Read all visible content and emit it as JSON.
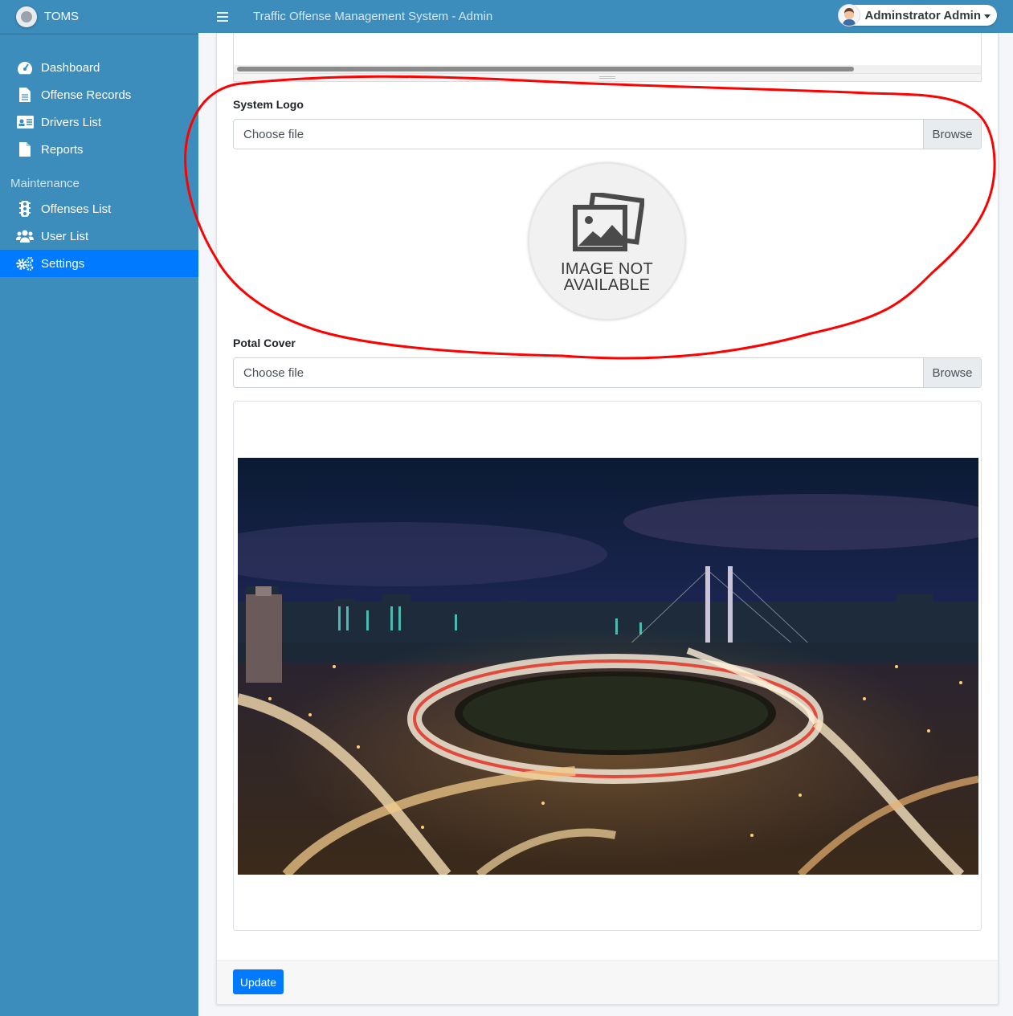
{
  "brand": {
    "name": "TOMS"
  },
  "header": {
    "title": "Traffic Offense Management System - Admin",
    "user_name": "Adminstrator Admin"
  },
  "sidebar": {
    "items": [
      {
        "label": "Dashboard",
        "icon": "tachometer-icon"
      },
      {
        "label": "Offense Records",
        "icon": "file-text-icon"
      },
      {
        "label": "Drivers List",
        "icon": "id-card-icon"
      },
      {
        "label": "Reports",
        "icon": "file-icon"
      }
    ],
    "section_header": "Maintenance",
    "maintenance_items": [
      {
        "label": "Offenses List",
        "icon": "traffic-light-icon"
      },
      {
        "label": "User List",
        "icon": "users-icon"
      },
      {
        "label": "Settings",
        "icon": "cogs-icon",
        "active": true
      }
    ]
  },
  "form": {
    "system_logo_label": "System Logo",
    "logo_file_placeholder": "Choose file",
    "logo_browse": "Browse",
    "logo_placeholder_line1": "IMAGE NOT",
    "logo_placeholder_line2": "AVAILABLE",
    "cover_label": "Potal Cover",
    "cover_file_placeholder": "Choose file",
    "cover_browse": "Browse",
    "update_button": "Update"
  },
  "colors": {
    "sidebar_bg": "#3c8dbc",
    "active_item": "#007bff",
    "primary_button": "#007bff",
    "annotation": "#ff0000"
  }
}
